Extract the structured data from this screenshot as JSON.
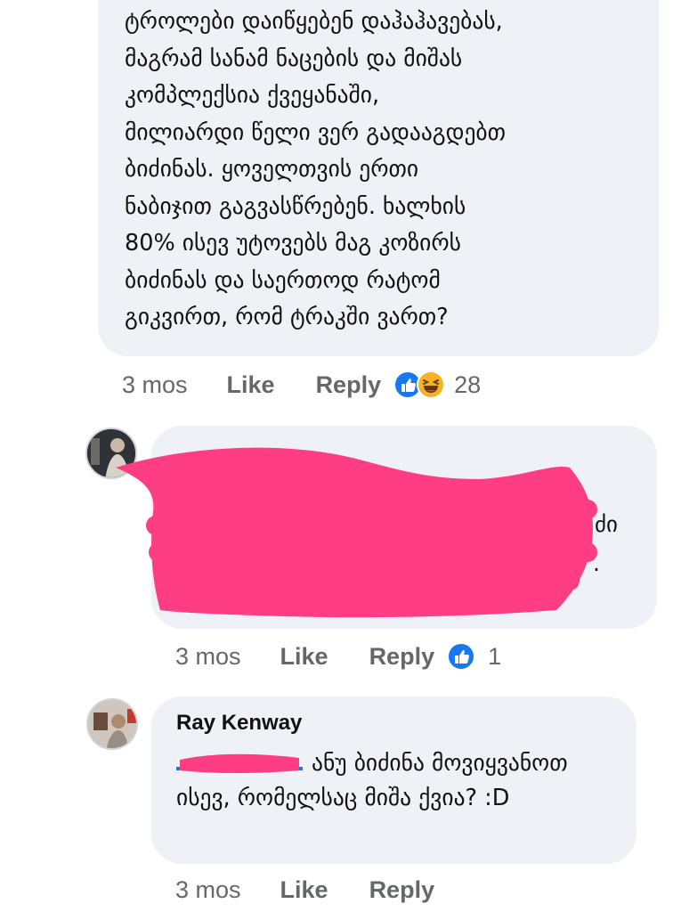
{
  "comments": [
    {
      "text": "ტროლები დაიწყებენ დაჰაჰავებას,\nმაგრამ სანამ ნაცების და მიშას\nკომპლექსია ქვეყანაში,\nმილიარდი წელი ვერ გადააგდებთ\nბიძინას. ყოველთვის ერთი\nნაბიჯით გაგვასწრებენ. ხალხის\n80% ისევ უტოვებს მაგ კოზირს\nბიძინას და საერთოდ რატომ\nგიკვირთ, რომ ტრაკში ვართ?",
      "time": "3 mos",
      "like_label": "Like",
      "reply_label": "Reply",
      "reactions": [
        "like",
        "haha"
      ],
      "reaction_count": "28"
    },
    {
      "time": "3 mos",
      "like_label": "Like",
      "reply_label": "Reply",
      "reactions": [
        "like"
      ],
      "reaction_count": "1"
    },
    {
      "author": "Ray Kenway",
      "text": "ანუ ბიძინა მოვიყვანოთ ისევ, რომელსაც მიშა ქვია? :D",
      "time": "3 mos",
      "like_label": "Like",
      "reply_label": "Reply"
    }
  ],
  "colors": {
    "bubble": "#eef1f5",
    "meta_text": "#65676b",
    "redaction": "#ff3d82",
    "like_blue": "#1877f2",
    "haha_yellow": "#f7b125"
  }
}
